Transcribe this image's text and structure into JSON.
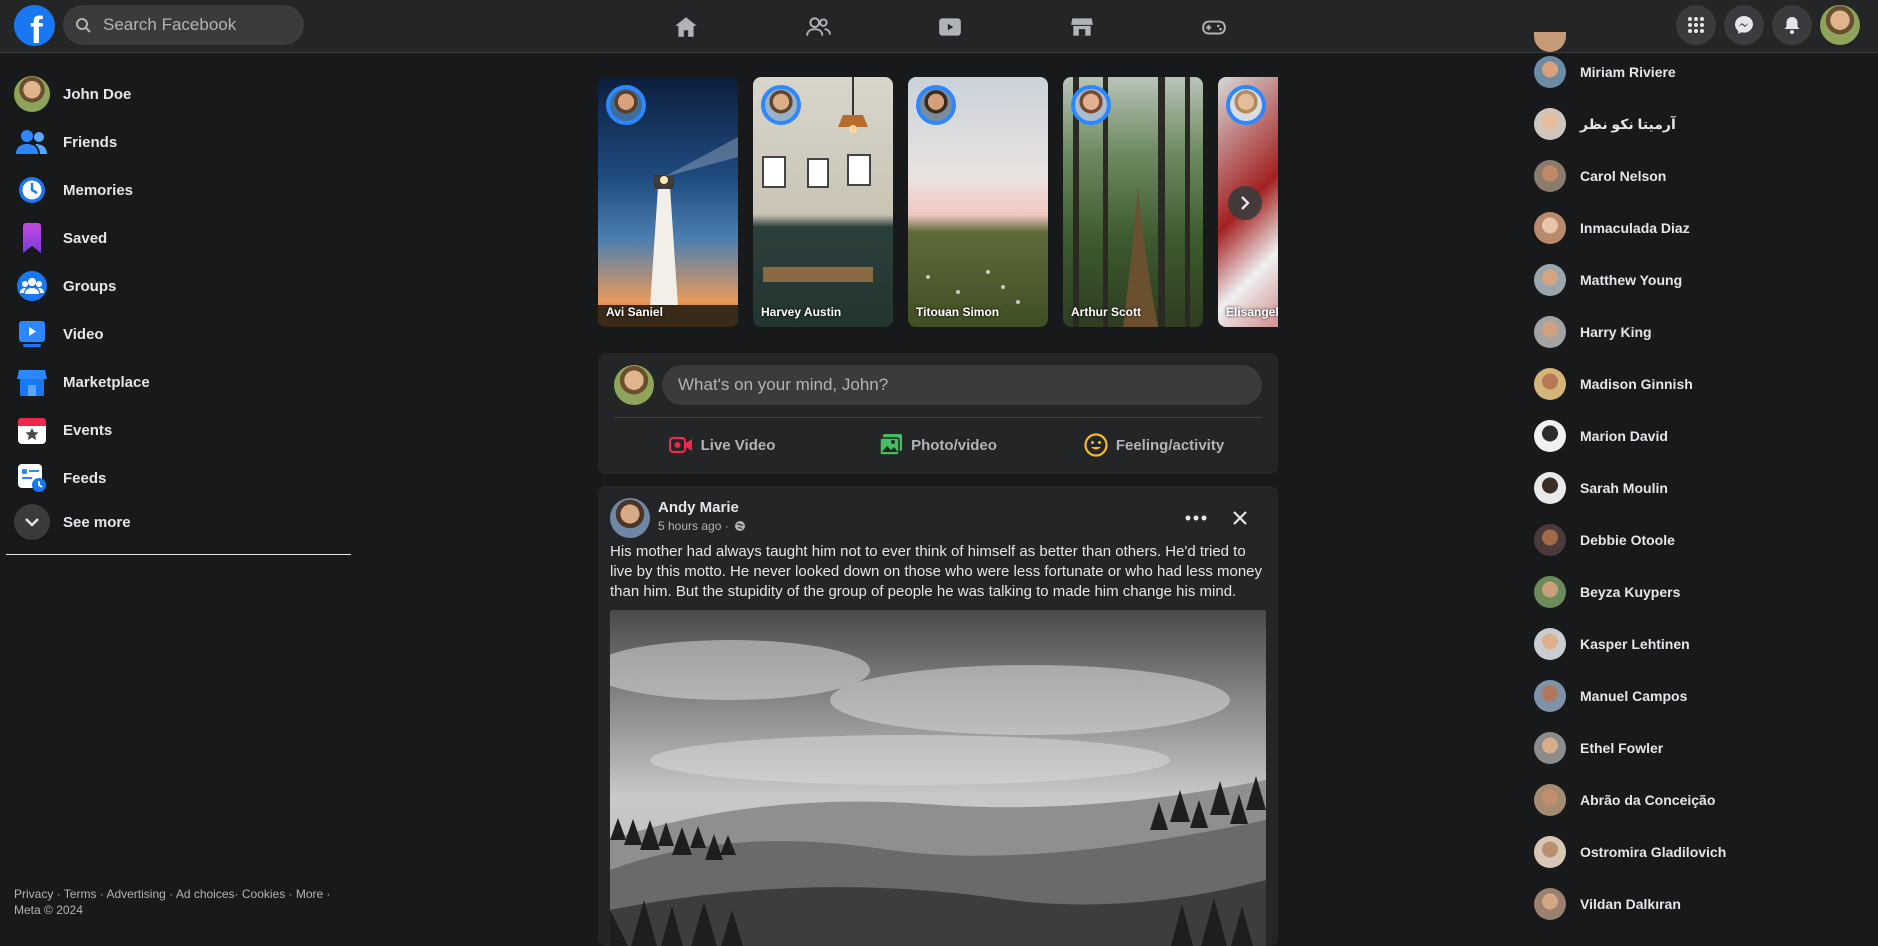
{
  "header": {
    "logo_letter": "f",
    "search_placeholder": "Search Facebook"
  },
  "user": {
    "name": "John Doe"
  },
  "sidebar": {
    "items": [
      {
        "label": "John Doe"
      },
      {
        "label": "Friends"
      },
      {
        "label": "Memories"
      },
      {
        "label": "Saved"
      },
      {
        "label": "Groups"
      },
      {
        "label": "Video"
      },
      {
        "label": "Marketplace"
      },
      {
        "label": "Events"
      },
      {
        "label": "Feeds"
      },
      {
        "label": "See more"
      }
    ]
  },
  "footer": {
    "links": "Privacy · Terms · Advertising · Ad choices· Cookies · More ·",
    "copyright": "Meta © 2024"
  },
  "stories": [
    {
      "name": "Avi Saniel"
    },
    {
      "name": "Harvey Austin"
    },
    {
      "name": "Titouan Simon"
    },
    {
      "name": "Arthur Scott"
    },
    {
      "name": "Elisangela"
    }
  ],
  "composer": {
    "placeholder": "What's on your mind, John?",
    "actions": [
      "Live Video",
      "Photo/video",
      "Feeling/activity"
    ]
  },
  "post": {
    "author": "Andy Marie",
    "time": "5 hours ago ·",
    "text": "His mother had always taught him not to ever think of himself as better than others. He'd tried to live by this motto. He never looked down on those who were less fortunate or who had less money than him. But the stupidity of the group of people he was talking to made him change his mind."
  },
  "contacts": [
    "Miriam Riviere",
    "آرميتا نكو نظر",
    "Carol Nelson",
    "Inmaculada Diaz",
    "Matthew Young",
    "Harry King",
    "Madison Ginnish",
    "Marion David",
    "Sarah Moulin",
    "Debbie Otoole",
    "Beyza Kuypers",
    "Kasper Lehtinen",
    "Manuel Campos",
    "Ethel Fowler",
    "Abrão da Conceição",
    "Ostromira Gladilovich",
    "Vildan Dalkıran"
  ],
  "colors": {
    "accent": "#1877f2",
    "bg": "#18191a",
    "surface": "#242526"
  }
}
